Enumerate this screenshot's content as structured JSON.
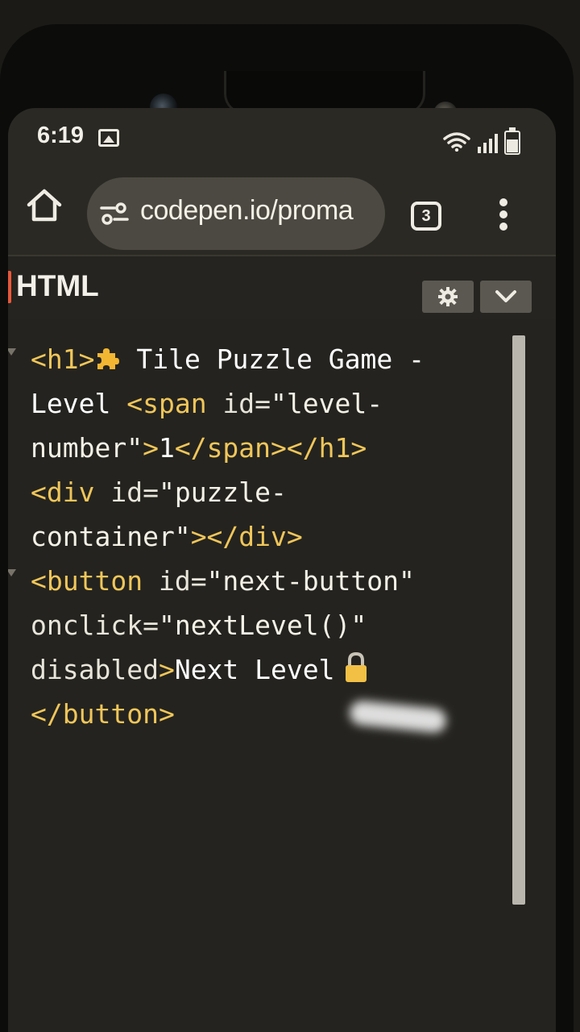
{
  "status_bar": {
    "time": "6:19"
  },
  "browser": {
    "url": "codepen.io/proma",
    "tab_count": "3"
  },
  "editor": {
    "title": "HTML",
    "lines": [
      [
        {
          "c": "tag",
          "t": "<h1>"
        },
        {
          "c": "icon",
          "t": "puzzle"
        },
        {
          "c": "txt",
          "t": " Tile Puzzle Game -"
        }
      ],
      [
        {
          "c": "txt",
          "t": "Level "
        },
        {
          "c": "tag",
          "t": "<span "
        },
        {
          "c": "attr",
          "t": "id="
        },
        {
          "c": "str",
          "t": "\"level-"
        }
      ],
      [
        {
          "c": "str",
          "t": "number\""
        },
        {
          "c": "tag",
          "t": ">"
        },
        {
          "c": "txt",
          "t": "1"
        },
        {
          "c": "tag",
          "t": "</span></h1>"
        }
      ],
      [
        {
          "c": "tag",
          "t": "<div "
        },
        {
          "c": "attr",
          "t": "id="
        },
        {
          "c": "str",
          "t": "\"puzzle-"
        }
      ],
      [
        {
          "c": "str",
          "t": "container\""
        },
        {
          "c": "tag",
          "t": "></div>"
        }
      ],
      [
        {
          "c": "tag",
          "t": "<button "
        },
        {
          "c": "attr",
          "t": "id="
        },
        {
          "c": "str",
          "t": "\"next-button\""
        }
      ],
      [
        {
          "c": "attr",
          "t": "onclick="
        },
        {
          "c": "str",
          "t": "\"nextLevel()\""
        }
      ],
      [
        {
          "c": "attr",
          "t": "disabled"
        },
        {
          "c": "tag",
          "t": ">"
        },
        {
          "c": "txt",
          "t": "Next Level"
        },
        {
          "c": "icon",
          "t": "lock"
        }
      ],
      [
        {
          "c": "tag",
          "t": "</button>"
        }
      ]
    ]
  },
  "colors": {
    "tag": "#f0c65a",
    "accent": "#e9583a"
  }
}
